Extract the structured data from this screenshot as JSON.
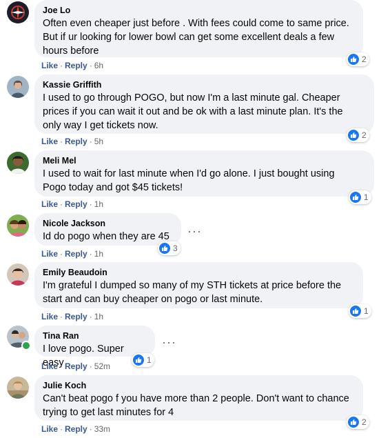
{
  "actions": {
    "like": "Like",
    "reply": "Reply",
    "separator": "·"
  },
  "more_label": "···",
  "comments": [
    {
      "author": "Joe Lo",
      "lines": [
        "Often even cheaper just before . With fees could come to same price.",
        "But if ur looking for lower bowl can get some excellent deals a few",
        "hours before"
      ],
      "reactions": "2",
      "time": "6h"
    },
    {
      "author": "Kassie Griffith",
      "lines": [
        "I used to go through POGO, but now I'm a last minute gal. Cheaper",
        "prices if you can wait it out and be ok with a last minute plan. It's the",
        "only way I get tickets now."
      ],
      "reactions": "2",
      "time": "5h"
    },
    {
      "author": "Meli Mel",
      "lines": [
        "I used to wait for last minute when I'd go alone. I just bought using",
        "Pogo today and got $45 tickets!"
      ],
      "reactions": "1",
      "time": "1h"
    },
    {
      "author": "Nicole Jackson",
      "lines": [
        "Id do pogo when they are 45"
      ],
      "reactions": "3",
      "time": "1h"
    },
    {
      "author": "Emily Beaudoin",
      "lines": [
        "I'm grateful I dumped so many of my STH tickets at price before the",
        "start and can buy cheaper on pogo or last minute."
      ],
      "reactions": "1",
      "time": "1h"
    },
    {
      "author": "Tina Ran",
      "lines": [
        "I love pogo. Super easy"
      ],
      "reactions": "1",
      "time": "52m"
    },
    {
      "author": "Julie Koch",
      "lines": [
        "Can't beat pogo f you have more than 2 people. Don't want to chance",
        "trying to get last minutes for 4"
      ],
      "reactions": "2",
      "time": "33m"
    }
  ],
  "colors": {
    "bubble": "#f0f2f5",
    "link": "#385898",
    "like_blue": "#1877f2",
    "online": "#31a24c"
  }
}
